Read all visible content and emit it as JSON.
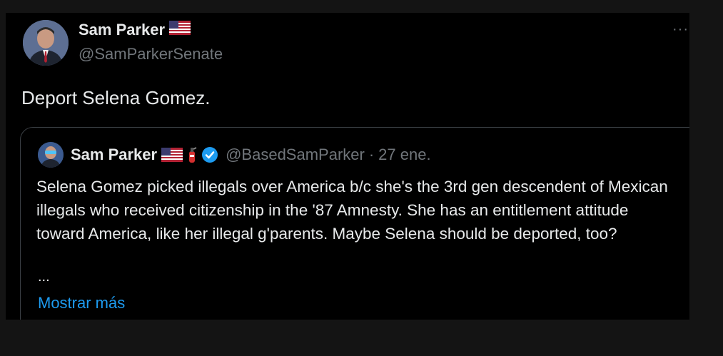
{
  "post": {
    "author_name": "Sam Parker",
    "author_handle": "@SamParkerSenate",
    "author_flag_icon": "us-flag-icon",
    "text": "Deport Selena Gomez.",
    "more_icon": "more-dots-icon",
    "more_label": "···"
  },
  "quoted": {
    "author_name": "Sam Parker",
    "author_handle": "@BasedSamParker",
    "separator": "·",
    "date": "27 ene.",
    "icons": [
      "us-flag-icon",
      "fire-extinguisher-icon",
      "verified-badge-icon"
    ],
    "text": "Selena Gomez picked illegals over America b/c she's the 3rd gen descendent of Mexican illegals who received citizenship in the '87 Amnesty. She has an entitlement attitude toward America, like her illegal g'parents. Maybe Selena should be deported, too?",
    "ellipsis": "...",
    "show_more": "Mostrar más"
  },
  "colors": {
    "background": "#000000",
    "outer": "#141414",
    "primary_text": "#e7e9ea",
    "secondary_text": "#71767b",
    "link": "#1d9bf0",
    "border": "#3a3f44"
  }
}
